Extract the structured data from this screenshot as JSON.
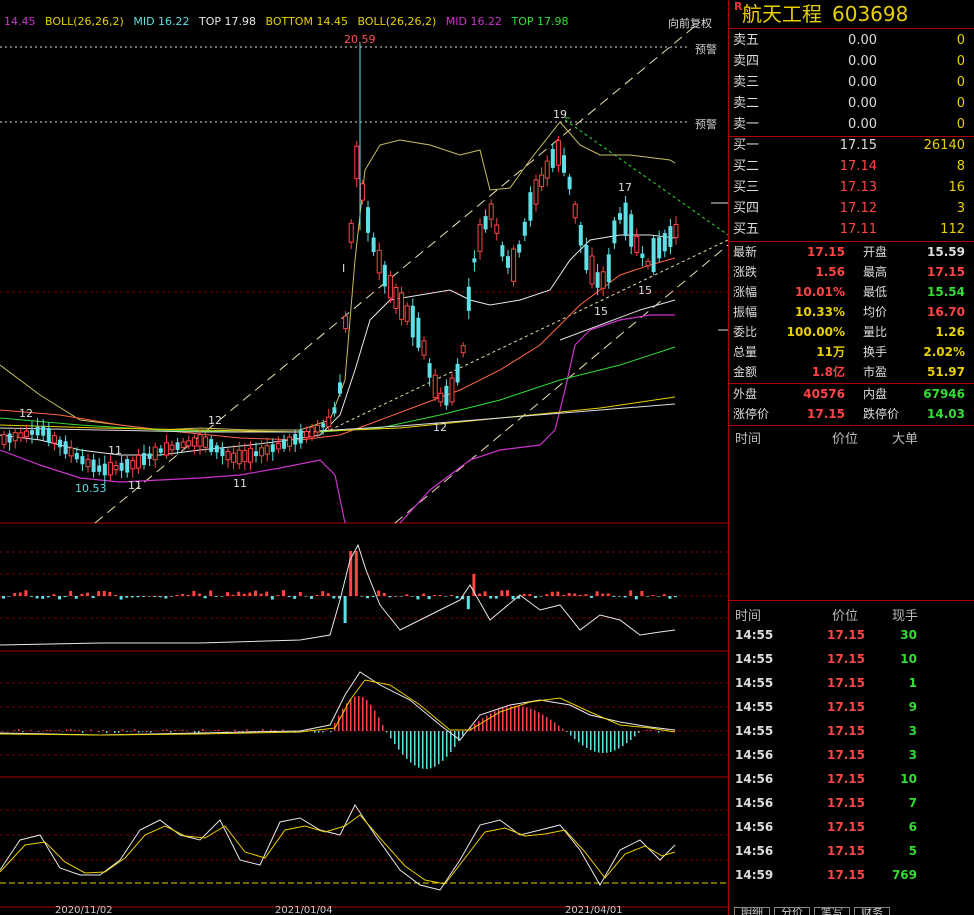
{
  "legend": {
    "partial": "14.45",
    "boll1": "BOLL(26,26,2)",
    "mid1": "MID 16.22",
    "top1": "TOP 17.98",
    "bottom": "BOTTOM 14.45",
    "boll2": "BOLL(26,26,2)",
    "mid2": "MID 16.22",
    "top2": "TOP 17.98"
  },
  "chart_labels": {
    "fuquan": "向前复权",
    "warn1": "预警",
    "warn2": "预警",
    "high_label": "20.59",
    "peak19": "19",
    "peak17": "17",
    "low15a": "15",
    "low15b": "15",
    "low12a": "12",
    "low12b": "12",
    "low12c": "12",
    "low11a": "11",
    "low11b": "11",
    "low11c": "11",
    "low1053": "10.53",
    "marker_i": "I"
  },
  "dates": [
    "2020/11/02",
    "2021/01/04",
    "2021/04/01"
  ],
  "stock": {
    "name": "航天工程",
    "code": "603698",
    "r_mark": "R"
  },
  "sell_orders": [
    {
      "label": "卖五",
      "price": "0.00",
      "volume": "0"
    },
    {
      "label": "卖四",
      "price": "0.00",
      "volume": "0"
    },
    {
      "label": "卖三",
      "price": "0.00",
      "volume": "0"
    },
    {
      "label": "卖二",
      "price": "0.00",
      "volume": "0"
    },
    {
      "label": "卖一",
      "price": "0.00",
      "volume": "0"
    }
  ],
  "buy_orders": [
    {
      "label": "买一",
      "price": "17.15",
      "volume": "26140"
    },
    {
      "label": "买二",
      "price": "17.14",
      "volume": "8"
    },
    {
      "label": "买三",
      "price": "17.13",
      "volume": "16"
    },
    {
      "label": "买四",
      "price": "17.12",
      "volume": "3"
    },
    {
      "label": "买五",
      "price": "17.11",
      "volume": "112"
    }
  ],
  "quote": [
    {
      "l1": "最新",
      "v1": "17.15",
      "c1": "red",
      "l2": "开盘",
      "v2": "15.59",
      "c2": "wht"
    },
    {
      "l1": "涨跌",
      "v1": "1.56",
      "c1": "red",
      "l2": "最高",
      "v2": "17.15",
      "c2": "red"
    },
    {
      "l1": "涨幅",
      "v1": "10.01%",
      "c1": "red",
      "l2": "最低",
      "v2": "15.54",
      "c2": "grn"
    },
    {
      "l1": "振幅",
      "v1": "10.33%",
      "c1": "yel",
      "l2": "均价",
      "v2": "16.70",
      "c2": "red"
    },
    {
      "l1": "委比",
      "v1": "100.00%",
      "c1": "yel",
      "l2": "量比",
      "v2": "1.26",
      "c2": "yel"
    },
    {
      "l1": "总量",
      "v1": "11万",
      "c1": "yel",
      "l2": "换手",
      "v2": "2.02%",
      "c2": "yel"
    },
    {
      "l1": "金额",
      "v1": "1.8亿",
      "c1": "red",
      "l2": "市盈",
      "v2": "51.97",
      "c2": "yel"
    }
  ],
  "outer_inner": [
    {
      "l1": "外盘",
      "v1": "40576",
      "c1": "red",
      "l2": "内盘",
      "v2": "67946",
      "c2": "grn"
    },
    {
      "l1": "涨停价",
      "v1": "17.15",
      "c1": "red",
      "l2": "跌停价",
      "v2": "14.03",
      "c2": "grn"
    }
  ],
  "bigorder_header": {
    "time": "时间",
    "price": "价位",
    "big": "大单"
  },
  "ticks_header": {
    "time": "时间",
    "price": "价位",
    "vol": "现手"
  },
  "ticks": [
    {
      "time": "14:55",
      "price": "17.15",
      "vol": "30"
    },
    {
      "time": "14:55",
      "price": "17.15",
      "vol": "10"
    },
    {
      "time": "14:55",
      "price": "17.15",
      "vol": "1"
    },
    {
      "time": "14:55",
      "price": "17.15",
      "vol": "9"
    },
    {
      "time": "14:55",
      "price": "17.15",
      "vol": "3"
    },
    {
      "time": "14:56",
      "price": "17.15",
      "vol": "3"
    },
    {
      "time": "14:56",
      "price": "17.15",
      "vol": "10"
    },
    {
      "time": "14:56",
      "price": "17.15",
      "vol": "7"
    },
    {
      "time": "14:56",
      "price": "17.15",
      "vol": "6"
    },
    {
      "time": "14:56",
      "price": "17.15",
      "vol": "5"
    },
    {
      "time": "14:59",
      "price": "17.15",
      "vol": "769"
    }
  ],
  "tabs": [
    "明细",
    "分价",
    "笔写",
    "财务"
  ],
  "colors": {
    "up": "#ff4444",
    "down": "#5ee0e6",
    "panel_border": "#b00000",
    "title": "#e8d000"
  }
}
